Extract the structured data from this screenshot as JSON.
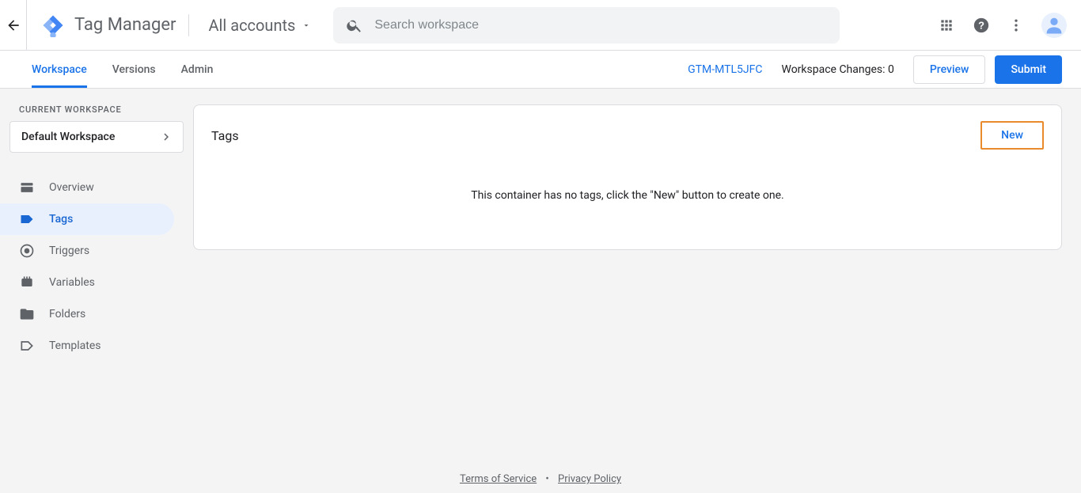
{
  "header": {
    "product_name": "Tag Manager",
    "accounts_label": "All accounts",
    "search_placeholder": "Search workspace"
  },
  "subbar": {
    "tabs": [
      {
        "label": "Workspace",
        "active": true
      },
      {
        "label": "Versions",
        "active": false
      },
      {
        "label": "Admin",
        "active": false
      }
    ],
    "container_id": "GTM-MTL5JFC",
    "changes_label": "Workspace Changes: 0",
    "preview_label": "Preview",
    "submit_label": "Submit"
  },
  "sidebar": {
    "current_workspace_label": "CURRENT WORKSPACE",
    "workspace_name": "Default Workspace",
    "nav": [
      {
        "label": "Overview",
        "icon": "overview"
      },
      {
        "label": "Tags",
        "icon": "tag"
      },
      {
        "label": "Triggers",
        "icon": "trigger"
      },
      {
        "label": "Variables",
        "icon": "variable"
      },
      {
        "label": "Folders",
        "icon": "folder"
      },
      {
        "label": "Templates",
        "icon": "template"
      }
    ]
  },
  "main": {
    "card_title": "Tags",
    "new_label": "New",
    "empty_message": "This container has no tags, click the \"New\" button to create one."
  },
  "footer": {
    "tos": "Terms of Service",
    "privacy": "Privacy Policy"
  }
}
